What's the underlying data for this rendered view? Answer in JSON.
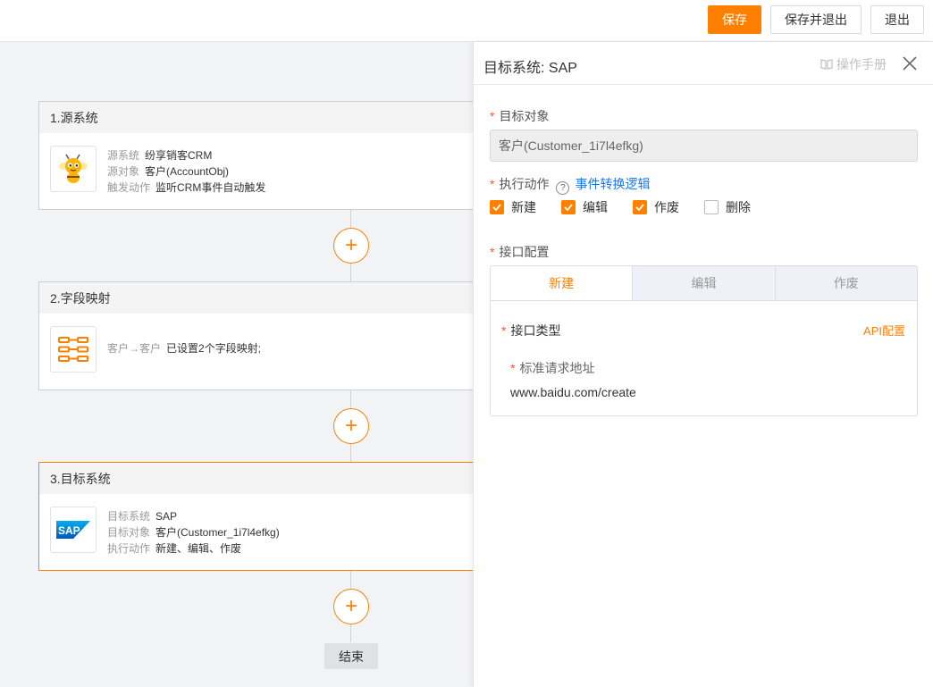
{
  "toolbar": {
    "save": "保存",
    "save_exit": "保存并退出",
    "exit": "退出"
  },
  "nodes": [
    {
      "title": "1.源系统",
      "rows": [
        {
          "k": "源系统",
          "v": "纷享销客CRM"
        },
        {
          "k": "源对象",
          "v": "客户(AccountObj)"
        },
        {
          "k": "触发动作",
          "v": "监听CRM事件自动触发"
        }
      ]
    },
    {
      "title": "2.字段映射",
      "k": "客户→客户",
      "v": "已设置2个字段映射;"
    },
    {
      "title": "3.目标系统",
      "rows": [
        {
          "k": "目标系统",
          "v": "SAP"
        },
        {
          "k": "目标对象",
          "v": "客户(Customer_1i7l4efkg)"
        },
        {
          "k": "执行动作",
          "v": "新建、编辑、作废"
        }
      ]
    }
  ],
  "add_symbol": "+",
  "end_label": "结束",
  "sap_logo_text": "SAP",
  "panel": {
    "title": "目标系统: SAP",
    "manual": "操作手册",
    "target_object_label": "目标对象",
    "target_object_value": "客户(Customer_1i7l4efkg)",
    "action_label": "执行动作",
    "help": "?",
    "action_link": "事件转换逻辑",
    "actions": [
      {
        "label": "新建",
        "checked": true
      },
      {
        "label": "编辑",
        "checked": true
      },
      {
        "label": "作废",
        "checked": true
      },
      {
        "label": "删除",
        "checked": false
      }
    ],
    "interface_label": "接口配置",
    "tabs": [
      "新建",
      "编辑",
      "作废"
    ],
    "api_type_label": "接口类型",
    "api_config": "API配置",
    "url_label": "标准请求地址",
    "url_value": "www.baidu.com/create"
  },
  "colors": {
    "accent": "#ff8000",
    "link": "#1677ff",
    "required": "#ff5630"
  },
  "icons": [
    "crm-bee-icon",
    "field-mapping-icon",
    "sap-logo-icon",
    "book-icon",
    "close-icon",
    "check-icon",
    "help-icon"
  ]
}
